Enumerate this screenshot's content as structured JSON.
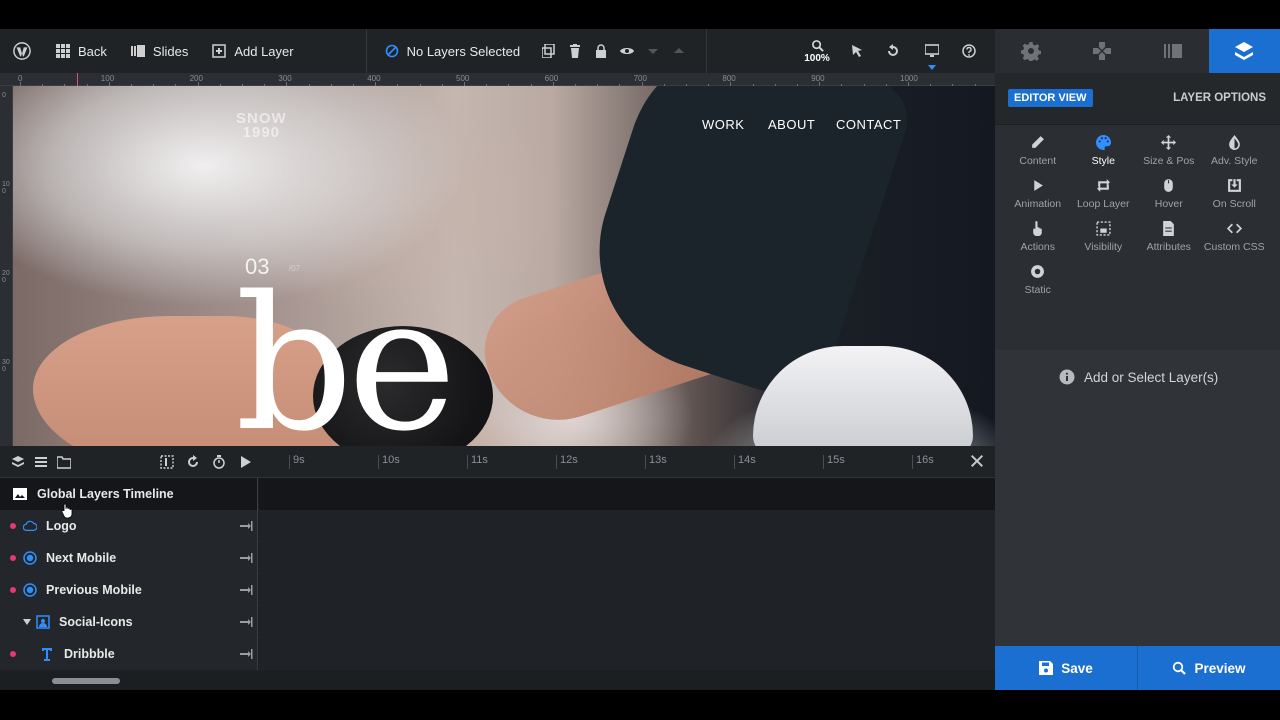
{
  "toolbar": {
    "back_label": "Back",
    "slides_label": "Slides",
    "add_layer_label": "Add Layer",
    "selection_status": "No Layers Selected",
    "zoom_level": "100%"
  },
  "ruler": {
    "top_labels": [
      "0",
      "100",
      "200",
      "300",
      "400",
      "500",
      "600",
      "700",
      "800",
      "900",
      "1000"
    ],
    "left_labels": [
      "0",
      "100",
      "200",
      "300"
    ]
  },
  "slide": {
    "logo_text": "SNOW\n1990",
    "nav": [
      "WORK",
      "ABOUT",
      "CONTACT"
    ],
    "number": "03",
    "number_suffix": "/07",
    "headline": "be"
  },
  "timeline": {
    "times": [
      "9s",
      "10s",
      "11s",
      "12s",
      "13s",
      "14s",
      "15s",
      "16s"
    ],
    "layers": [
      {
        "name": "Global Layers Timeline",
        "type": "global"
      },
      {
        "name": "Logo",
        "icon": "cloud-icon"
      },
      {
        "name": "Next Mobile",
        "icon": "circle-target-icon"
      },
      {
        "name": "Previous Mobile",
        "icon": "circle-target-icon"
      },
      {
        "name": "Social-Icons",
        "icon": "group-icon",
        "expanded": true
      },
      {
        "name": "Dribbble",
        "icon": "text-icon",
        "child": true
      }
    ]
  },
  "panel": {
    "editor_view_label": "EDITOR VIEW",
    "layer_options_label": "LAYER OPTIONS",
    "options": [
      {
        "label": "Content",
        "icon": "pencil-icon"
      },
      {
        "label": "Style",
        "icon": "palette-icon",
        "active": true
      },
      {
        "label": "Size & Pos",
        "icon": "move-icon"
      },
      {
        "label": "Adv. Style",
        "icon": "contrast-icon"
      },
      {
        "label": "Animation",
        "icon": "play-icon"
      },
      {
        "label": "Loop Layer",
        "icon": "loop-icon"
      },
      {
        "label": "Hover",
        "icon": "mouse-icon"
      },
      {
        "label": "On Scroll",
        "icon": "scroll-download-icon"
      },
      {
        "label": "Actions",
        "icon": "hand-pointer-icon"
      },
      {
        "label": "Visibility",
        "icon": "visibility-icon"
      },
      {
        "label": "Attributes",
        "icon": "document-icon"
      },
      {
        "label": "Custom CSS",
        "icon": "code-icon"
      },
      {
        "label": "Static",
        "icon": "dot-circle-icon"
      }
    ],
    "hint_text": "Add or Select Layer(s)",
    "save_label": "Save",
    "preview_label": "Preview"
  },
  "colors": {
    "accent": "#1b6fd1",
    "toolbar_bg": "#202326",
    "panel_bg": "#2b2e32",
    "layer_dot": "#e5397a"
  }
}
